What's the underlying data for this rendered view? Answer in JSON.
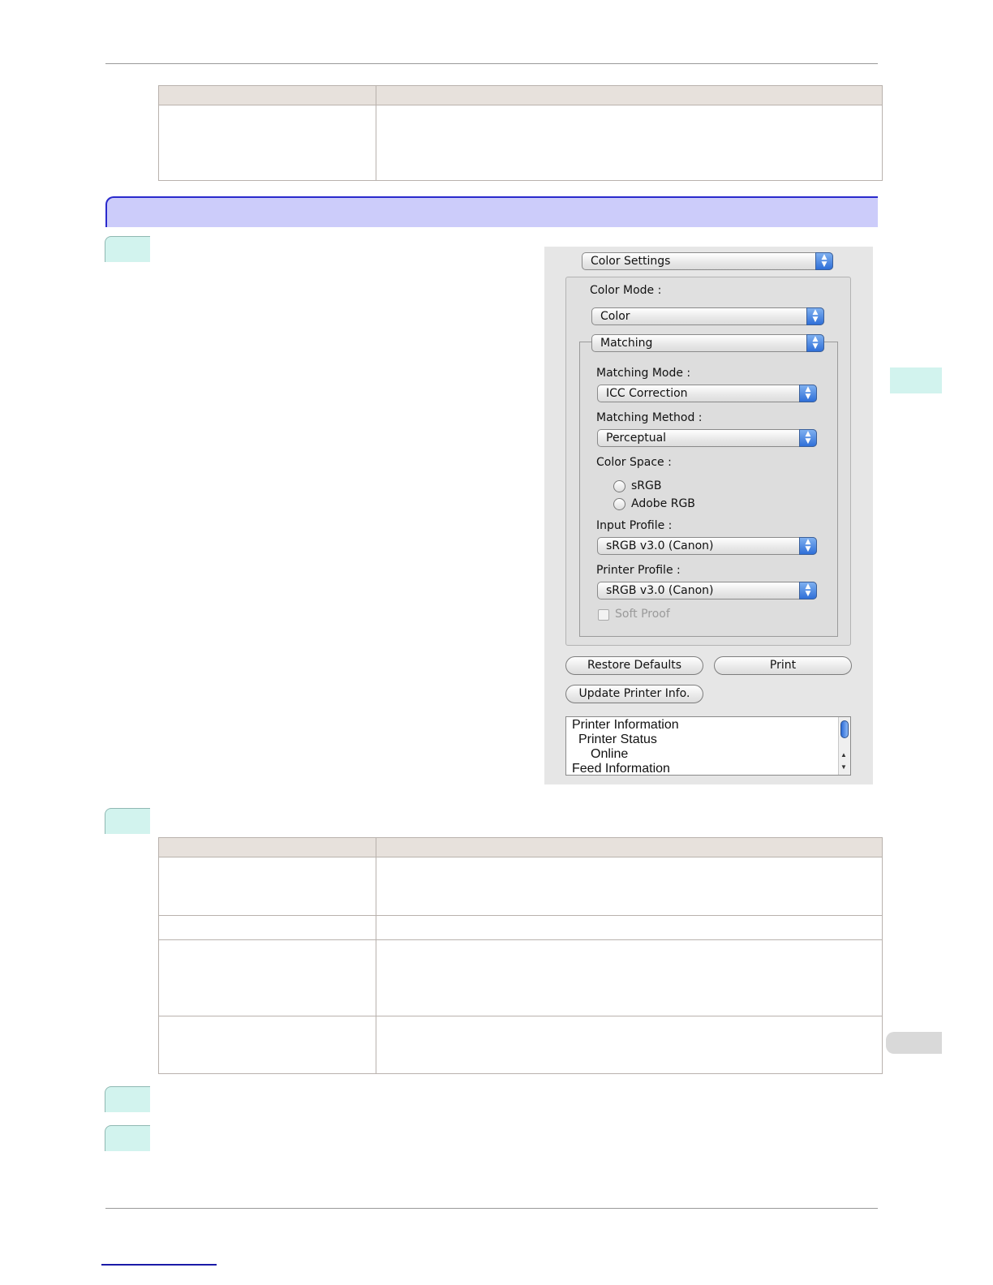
{
  "dialog": {
    "panel_popup": "Color Settings",
    "color_mode_label": "Color Mode :",
    "color_mode_value": "Color",
    "matching_popup": "Matching",
    "matching_mode_label": "Matching Mode :",
    "matching_mode_value": "ICC Correction",
    "matching_method_label": "Matching Method :",
    "matching_method_value": "Perceptual",
    "color_space_label": "Color Space :",
    "color_space_options": [
      "sRGB",
      "Adobe RGB"
    ],
    "input_profile_label": "Input Profile :",
    "input_profile_value": "sRGB v3.0 (Canon)",
    "printer_profile_label": "Printer Profile :",
    "printer_profile_value": "sRGB v3.0 (Canon)",
    "soft_proof_label": "Soft Proof",
    "buttons": {
      "restore_defaults": "Restore Defaults",
      "print": "Print",
      "update_printer_info": "Update Printer Info."
    },
    "printer_info_list": [
      "Printer Information",
      "Printer Status",
      "Online",
      "Feed Information"
    ]
  }
}
